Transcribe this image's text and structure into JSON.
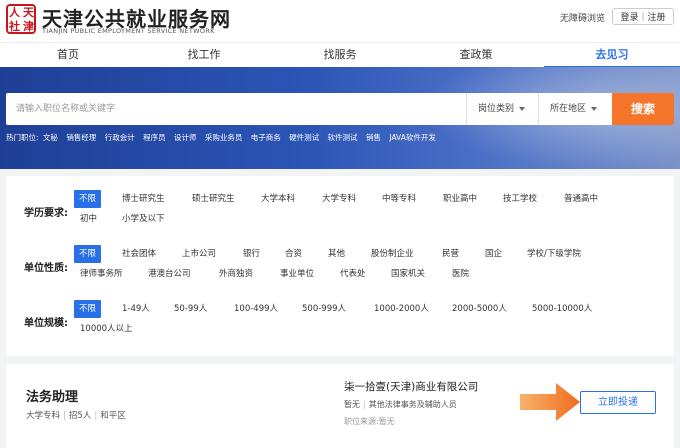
{
  "header": {
    "logo_chars": [
      "人",
      "天",
      "社",
      "津"
    ],
    "title": "天津公共就业服务网",
    "subtitle": "TIANJIN PUBLIC EMPLOYMENT SERVICE NETWORK",
    "accessibility": "无障碍浏览",
    "login": "登录",
    "separator": "|",
    "register": "注册"
  },
  "nav": {
    "items": [
      "首页",
      "找工作",
      "找服务",
      "查政策",
      "去见习"
    ],
    "active_index": 4
  },
  "search": {
    "placeholder": "请输入职位名称或关键字",
    "value": "",
    "category_label": "岗位类别",
    "region_label": "所在地区",
    "button": "搜索"
  },
  "hot_jobs": {
    "label": "热门职位:",
    "items": [
      "文秘",
      "销售经理",
      "行政会计",
      "程序员",
      "设计师",
      "采购业务员",
      "电子商务",
      "硬件测试",
      "软件测试",
      "销售",
      "JAVA软件开发"
    ]
  },
  "filters": {
    "education": {
      "label": "学历要求:",
      "options": [
        "不限",
        "博士研究生",
        "硕士研究生",
        "大学本科",
        "大学专科",
        "中等专科",
        "职业高中",
        "技工学校",
        "普通高中",
        "初中",
        "小学及以下"
      ],
      "selected": "不限"
    },
    "unit_type": {
      "label": "单位性质:",
      "options": [
        "不限",
        "社会团体",
        "上市公司",
        "银行",
        "合资",
        "其他",
        "股份制企业",
        "民营",
        "国企",
        "学校/下级学院",
        "律师事务所",
        "港澳台公司",
        "外商独资",
        "事业单位",
        "代表处",
        "国家机关",
        "医院"
      ],
      "selected": "不限"
    },
    "unit_size": {
      "label": "单位规模:",
      "options": [
        "不限",
        "1-49人",
        "50-99人",
        "100-499人",
        "500-999人",
        "1000-2000人",
        "2000-5000人",
        "5000-10000人",
        "10000人以上"
      ],
      "selected": "不限"
    }
  },
  "job": {
    "title": "法务助理",
    "education": "大学专科",
    "headcount": "招5人",
    "district": "和平区",
    "company": "柒一拾壹(天津)商业有限公司",
    "company_status": "暂无",
    "industry": "其他法律事务及辅助人员",
    "source_label": "职位来源:暂无",
    "apply": "立即投递"
  },
  "colors": {
    "accent": "#2970e8",
    "search_button": "#f5752a",
    "brand_red": "#c8161d",
    "arrow": "#f28a2e"
  },
  "icons": {
    "dropdown": "chevron-down-icon",
    "pointer_arrow": "arrow-right-icon"
  }
}
